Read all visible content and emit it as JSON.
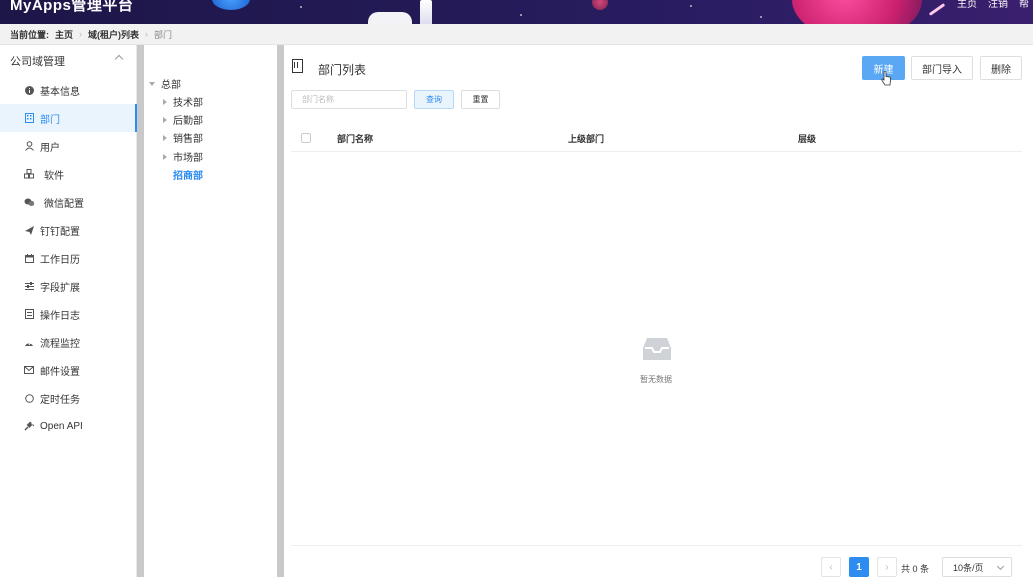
{
  "header": {
    "brand": "MyApps管理平台",
    "nav": [
      "主页",
      "注销",
      "帮"
    ]
  },
  "breadcrumb": {
    "lead": "当前位置:",
    "items": [
      "主页",
      "域(租户)列表",
      "部门"
    ]
  },
  "sidebar": {
    "section": "公司域管理",
    "items": [
      {
        "label": "基本信息",
        "icon": "info-icon"
      },
      {
        "label": "部门",
        "icon": "building-icon"
      },
      {
        "label": "用户",
        "icon": "user-icon"
      },
      {
        "label": "软件",
        "icon": "cubes-icon"
      },
      {
        "label": "微信配置",
        "icon": "wechat-icon"
      },
      {
        "label": "钉钉配置",
        "icon": "plane-icon"
      },
      {
        "label": "工作日历",
        "icon": "calendar-icon"
      },
      {
        "label": "字段扩展",
        "icon": "sliders-icon"
      },
      {
        "label": "操作日志",
        "icon": "log-icon"
      },
      {
        "label": "流程监控",
        "icon": "dashboard-icon"
      },
      {
        "label": "邮件设置",
        "icon": "mail-icon"
      },
      {
        "label": "定时任务",
        "icon": "circle-icon"
      },
      {
        "label": "Open API",
        "icon": "plug-icon"
      }
    ],
    "active_index": 1
  },
  "tree": {
    "root": "总部",
    "children": [
      "技术部",
      "后勤部",
      "销售部",
      "市场部",
      "招商部"
    ],
    "selected": "招商部"
  },
  "main": {
    "title": "部门列表",
    "buttons": {
      "new": "新建",
      "import": "部门导入",
      "delete": "删除"
    },
    "search": {
      "placeholder": "部门名称",
      "query": "查询",
      "reset": "重置"
    },
    "columns": [
      "部门名称",
      "上级部门",
      "层级"
    ],
    "empty_text": "暂无数据",
    "pager": {
      "current": "1",
      "total_text": "共 0 条",
      "page_size": "10条/页",
      "prev": "‹",
      "next": "›"
    }
  },
  "colors": {
    "accent": "#2d8cf0",
    "primary_button": "#5aa7f4"
  }
}
